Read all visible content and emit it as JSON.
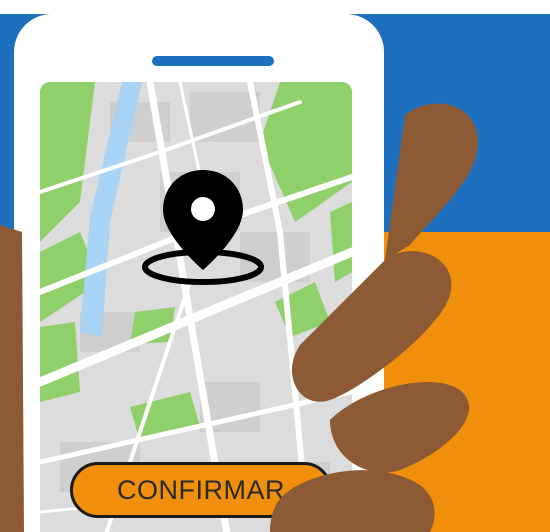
{
  "button": {
    "label": "CONFIRMAR"
  },
  "colors": {
    "blue": "#1f6fbf",
    "orange": "#ef8f0b",
    "skin": "#8c5a34",
    "park": "#8fd06a",
    "water": "#a9d4f5",
    "street": "#ffffff",
    "block": "#d9d9d9"
  },
  "icons": {
    "pin": "location-pin-icon"
  }
}
